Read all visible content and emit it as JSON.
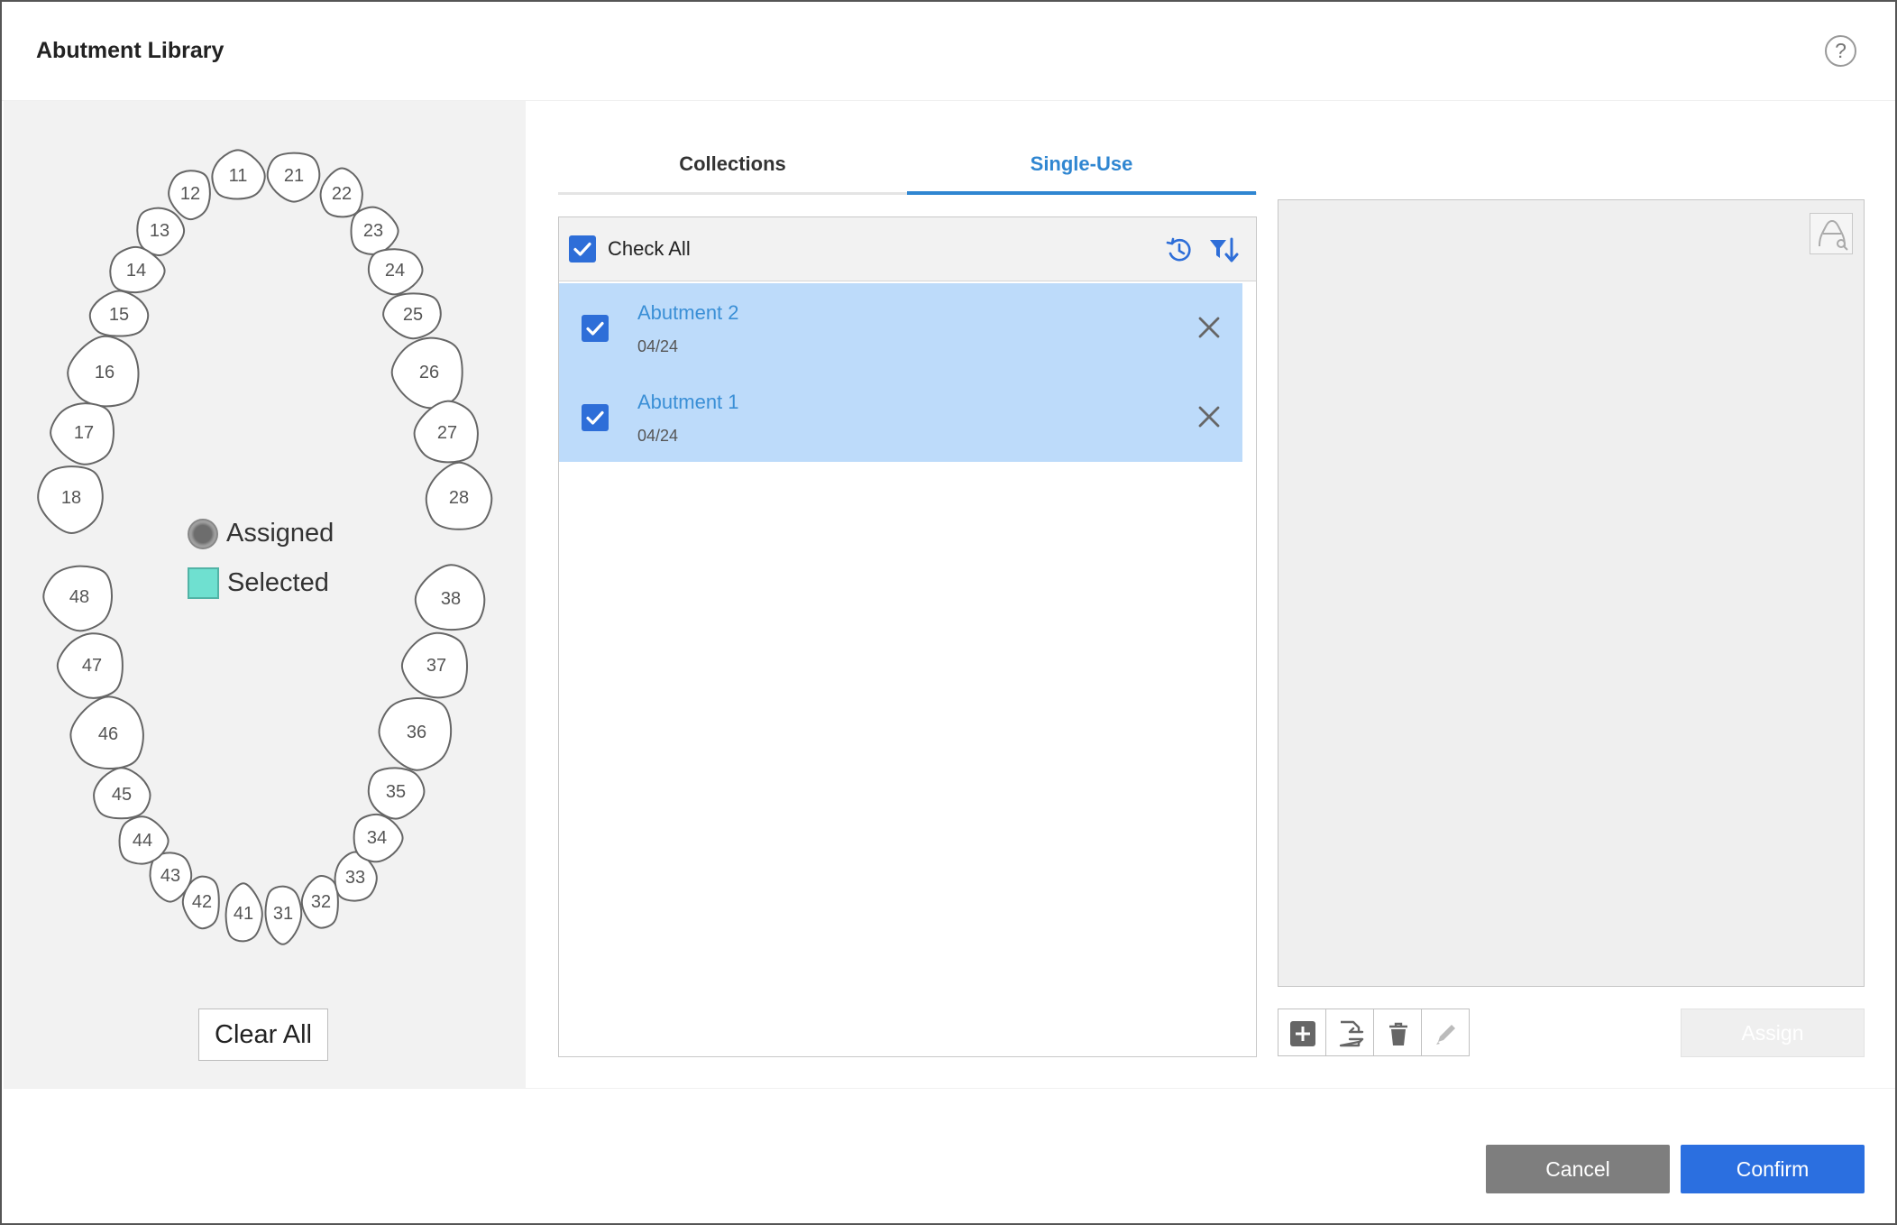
{
  "dialog": {
    "title": "Abutment Library",
    "help_label": "?"
  },
  "tooth_chart": {
    "teeth": [
      "11",
      "12",
      "13",
      "14",
      "15",
      "16",
      "17",
      "18",
      "21",
      "22",
      "23",
      "24",
      "25",
      "26",
      "27",
      "28",
      "31",
      "32",
      "33",
      "34",
      "35",
      "36",
      "37",
      "38",
      "41",
      "42",
      "43",
      "44",
      "45",
      "46",
      "47",
      "48"
    ],
    "legend": {
      "assigned": "Assigned",
      "selected": "Selected",
      "assigned_color": "#888888",
      "selected_color": "#6fe0d0"
    },
    "clear_all_label": "Clear All"
  },
  "tabs": [
    {
      "label": "Collections",
      "active": false
    },
    {
      "label": "Single-Use",
      "active": true
    }
  ],
  "list": {
    "check_all_label": "Check All",
    "check_all_checked": true,
    "items": [
      {
        "name": "Abutment 2",
        "date": "04/24",
        "checked": true
      },
      {
        "name": "Abutment 1",
        "date": "04/24",
        "checked": true
      }
    ]
  },
  "actions": {
    "assign_label": "Assign",
    "cancel_label": "Cancel",
    "confirm_label": "Confirm"
  },
  "colors": {
    "accent": "#2b6fe0",
    "tab_active": "#2f86d1",
    "row_selected": "#bddbfa",
    "panel_bg": "#f2f2f2"
  },
  "icons": {
    "help": "help-icon",
    "history": "history-icon",
    "sort": "filter-sort-icon",
    "remove": "close-icon",
    "preview": "preview-mode-icon",
    "add": "add-icon",
    "import": "import-icon",
    "delete": "trash-icon",
    "edit": "pencil-icon"
  }
}
